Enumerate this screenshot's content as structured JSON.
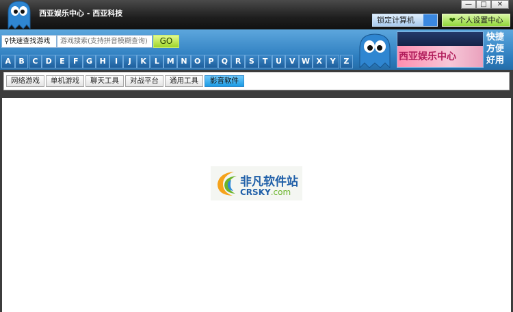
{
  "window": {
    "title": "西亚娱乐中心 - 西亚科技",
    "minimize_glyph": "—",
    "restore_glyph": "□",
    "close_glyph": "✕"
  },
  "header": {
    "lock_button": "锁定计算机",
    "personal_button": "个人设置中心",
    "personal_icon": "heart-icon"
  },
  "search": {
    "label": "快速查找游戏",
    "placeholder": "游戏搜索(支持拼音模糊查询)",
    "go_label": "GO",
    "icon": "search-icon"
  },
  "letters": [
    "A",
    "B",
    "C",
    "D",
    "E",
    "F",
    "G",
    "H",
    "I",
    "J",
    "K",
    "L",
    "M",
    "N",
    "O",
    "P",
    "Q",
    "R",
    "S",
    "T",
    "U",
    "V",
    "W",
    "X",
    "Y",
    "Z"
  ],
  "ad": {
    "brand": "西亚娱乐中心",
    "slogan": [
      "快捷",
      "方便",
      "好用"
    ]
  },
  "tabs": [
    {
      "label": "网络游戏",
      "active": false
    },
    {
      "label": "单机游戏",
      "active": false
    },
    {
      "label": "聊天工具",
      "active": false
    },
    {
      "label": "对战平台",
      "active": false
    },
    {
      "label": "通用工具",
      "active": false
    },
    {
      "label": "影音软件",
      "active": true
    }
  ],
  "watermark": {
    "line1": "非凡软件站",
    "line2_main": "CRSKY",
    "line2_domain": ".com"
  },
  "colors": {
    "banner_blue": "#2d7dbf",
    "go_green": "#9fd52a",
    "tab_active": "#1c9be4"
  }
}
